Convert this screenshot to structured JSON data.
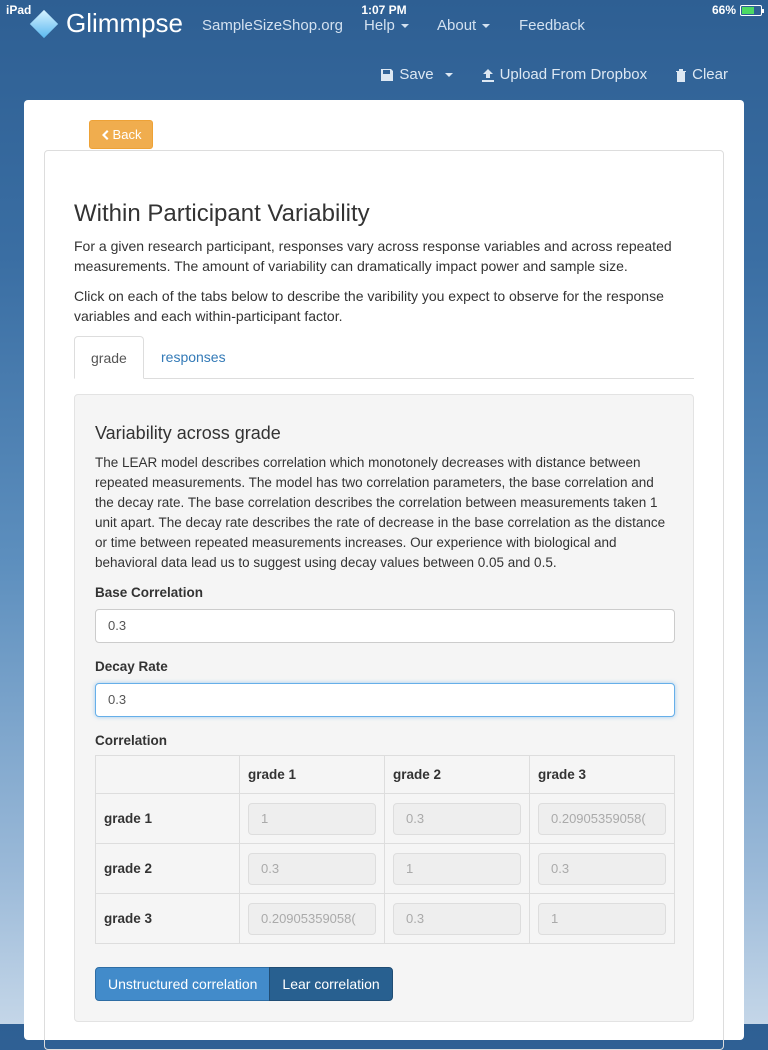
{
  "statusbar": {
    "device": "iPad",
    "time": "1:07 PM",
    "battery": "66%",
    "battery_level": 0.66
  },
  "navbar": {
    "brand": "Glimmpse",
    "links": [
      {
        "label": "SampleSizeShop.org"
      },
      {
        "label": "Help"
      },
      {
        "label": "About"
      },
      {
        "label": "Feedback"
      }
    ]
  },
  "toolbar": {
    "save": "Save",
    "upload": "Upload From Dropbox",
    "clear": "Clear"
  },
  "back_button": "Back",
  "page": {
    "title": "Within Participant Variability",
    "intro": "For a given research participant, responses vary across response variables and across repeated measurements. The amount of variability can dramatically impact power and sample size.",
    "instructions": "Click on each of the tabs below to describe the varibility you expect to observe for the response variables and each within-participant factor.",
    "tabs": [
      {
        "label": "grade"
      },
      {
        "label": "responses"
      }
    ]
  },
  "section": {
    "title": "Variability across grade",
    "description": "The LEAR model describes correlation which monotonely decreases with distance between repeated measurements. The model has two correlation parameters, the base correlation and the decay rate. The base correlation describes the correlation between measurements taken 1 unit apart. The decay rate describes the rate of decrease in the base correlation as the distance or time between repeated measurements increases. Our experience with biological and behavioral data lead us to suggest using decay values between 0.05 and 0.5.",
    "base_correlation": {
      "label": "Base Correlation",
      "value": "0.3"
    },
    "decay_rate": {
      "label": "Decay Rate",
      "value": "0.3"
    },
    "correlation": {
      "label": "Correlation",
      "columns": [
        "grade 1",
        "grade 2",
        "grade 3"
      ],
      "rows": [
        {
          "label": "grade 1",
          "values": [
            "1",
            "0.3",
            "0.20905359058("
          ]
        },
        {
          "label": "grade 2",
          "values": [
            "0.3",
            "1",
            "0.3"
          ]
        },
        {
          "label": "grade 3",
          "values": [
            "0.20905359058(",
            "0.3",
            "1"
          ]
        }
      ]
    },
    "buttons": {
      "unstructured": "Unstructured correlation",
      "lear": "Lear correlation"
    }
  }
}
